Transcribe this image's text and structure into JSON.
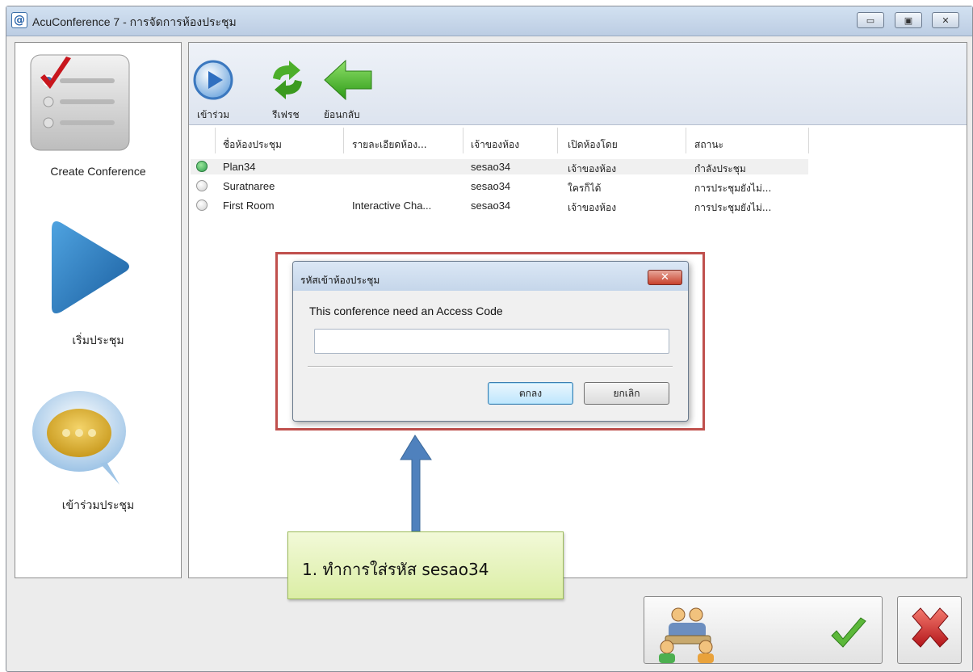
{
  "window": {
    "app_icon": "@",
    "title": "AcuConference 7 - การจัดการห้องประชุม",
    "minimize_icon": "minimize-icon",
    "maximize_icon": "maximize-icon",
    "close_icon": "close-icon"
  },
  "sidebar": {
    "items": [
      {
        "label": "Create Conference",
        "icon": "checklist-icon"
      },
      {
        "label": "เริ่มประชุม",
        "icon": "play-icon"
      },
      {
        "label": "เข้าร่วมประชุม",
        "icon": "chat-bubble-icon"
      }
    ]
  },
  "toolbar": {
    "join_label": "เข้าร่วม",
    "refresh_label": "รีเฟรช",
    "back_label": "ย้อนกลับ"
  },
  "table": {
    "headers": [
      "ชื่อห้องประชุม",
      "รายละเอียดห้อง...",
      "เจ้าของห้อง",
      "เปิดห้องโดย",
      "สถานะ"
    ],
    "rows": [
      {
        "status": "active",
        "name": "Plan34",
        "detail": "",
        "owner": "sesao34",
        "opened_by": "เจ้าของห้อง",
        "state": "กำลังประชุม"
      },
      {
        "status": "idle",
        "name": "Suratnaree",
        "detail": "",
        "owner": "sesao34",
        "opened_by": "ใครก็ได้",
        "state": "การประชุมยังไม่..."
      },
      {
        "status": "idle",
        "name": "First Room",
        "detail": "Interactive Cha...",
        "owner": "sesao34",
        "opened_by": "เจ้าของห้อง",
        "state": "การประชุมยังไม่..."
      }
    ]
  },
  "dialog": {
    "title": "รหัสเข้าห้องประชุม",
    "close_label": "✕",
    "message": "This conference need an Access Code",
    "input_value": "",
    "ok_label": "ตกลง",
    "cancel_label": "ยกเลิก"
  },
  "annotation": {
    "text": "1. ทำการใส่รหัส sesao34"
  },
  "colors": {
    "highlight_border": "#c0504d",
    "note_fill": "#e4f2b5",
    "arrow": "#4f81bd",
    "active_status": "#3cb371"
  }
}
